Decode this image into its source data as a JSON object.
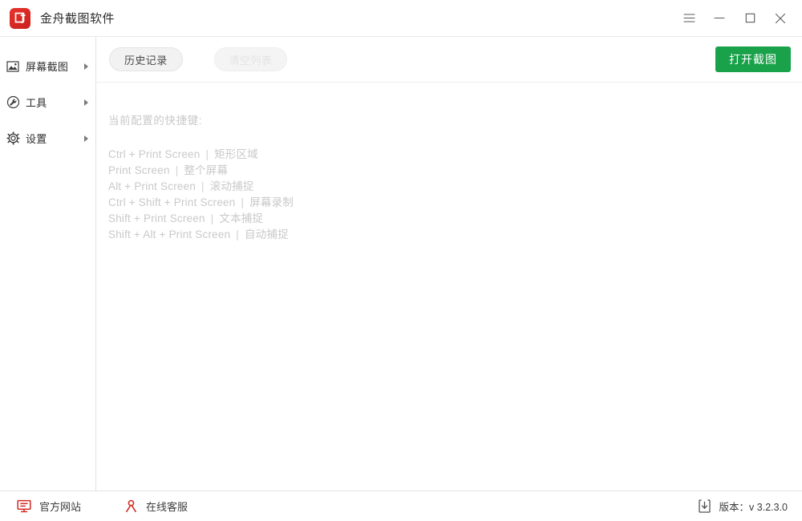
{
  "window": {
    "title": "金舟截图软件",
    "app_icon": "app-logo-icon",
    "controls": {
      "menu": "menu-hamburger-icon",
      "minimize": "minimize-icon",
      "maximize": "maximize-icon",
      "close": "close-icon"
    },
    "accent_red": "#d32219",
    "accent_green": "#19a24a"
  },
  "sidebar": {
    "items": [
      {
        "label": "屏幕截图",
        "icon": "image-capture-icon"
      },
      {
        "label": "工具",
        "icon": "wrench-icon"
      },
      {
        "label": "设置",
        "icon": "gear-icon"
      }
    ]
  },
  "toolbar": {
    "history_label": "历史记录",
    "clear_label": "清空列表",
    "open_label": "打开截图"
  },
  "panel": {
    "heading": "当前配置的快捷键:",
    "separator": "|",
    "shortcuts": [
      {
        "keys": "Ctrl + Print Screen",
        "action": "矩形区域"
      },
      {
        "keys": "Print Screen",
        "action": "整个屏幕"
      },
      {
        "keys": "Alt + Print Screen",
        "action": "滚动捕捉"
      },
      {
        "keys": "Ctrl + Shift + Print Screen",
        "action": "屏幕录制"
      },
      {
        "keys": "Shift + Print Screen",
        "action": "文本捕捉"
      },
      {
        "keys": "Shift + Alt + Print Screen",
        "action": "自动捕捉"
      }
    ]
  },
  "footer": {
    "website_label": "官方网站",
    "website_icon": "monitor-icon",
    "support_label": "在线客服",
    "support_icon": "person-icon",
    "version_icon": "download-icon",
    "version_label": "版本：v 3.2.3.0"
  }
}
